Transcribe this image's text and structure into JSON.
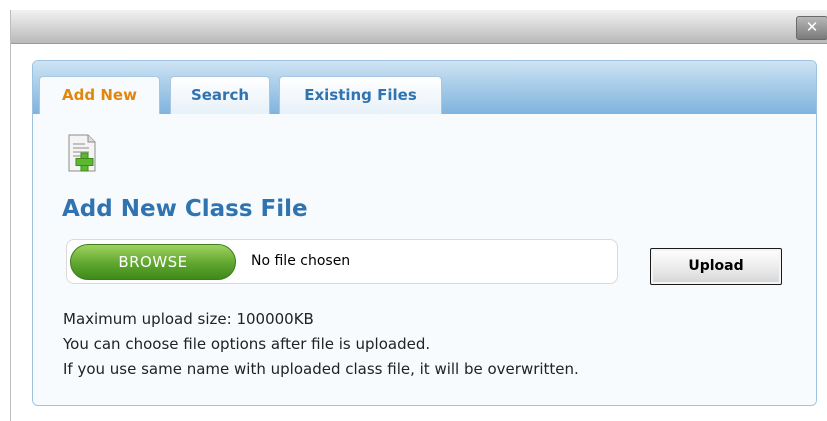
{
  "titlebar": {
    "close_label": "✕"
  },
  "tabs": [
    {
      "label": "Add New",
      "active": true
    },
    {
      "label": "Search",
      "active": false
    },
    {
      "label": "Existing Files",
      "active": false
    }
  ],
  "content": {
    "icon": "file-add-icon",
    "heading": "Add New Class File",
    "browse_label": "BROWSE",
    "file_status": "No file chosen",
    "upload_label": "Upload",
    "info": [
      "Maximum upload size: 100000KB",
      "You can choose file options after file is uploaded.",
      "If you use same name with uploaded class file, it will be overwritten."
    ]
  },
  "colors": {
    "accent": "#2f73b0",
    "active_tab": "#e2860d",
    "browse_green": "#5fa630",
    "tabbar_blue": "#a9cde9"
  }
}
